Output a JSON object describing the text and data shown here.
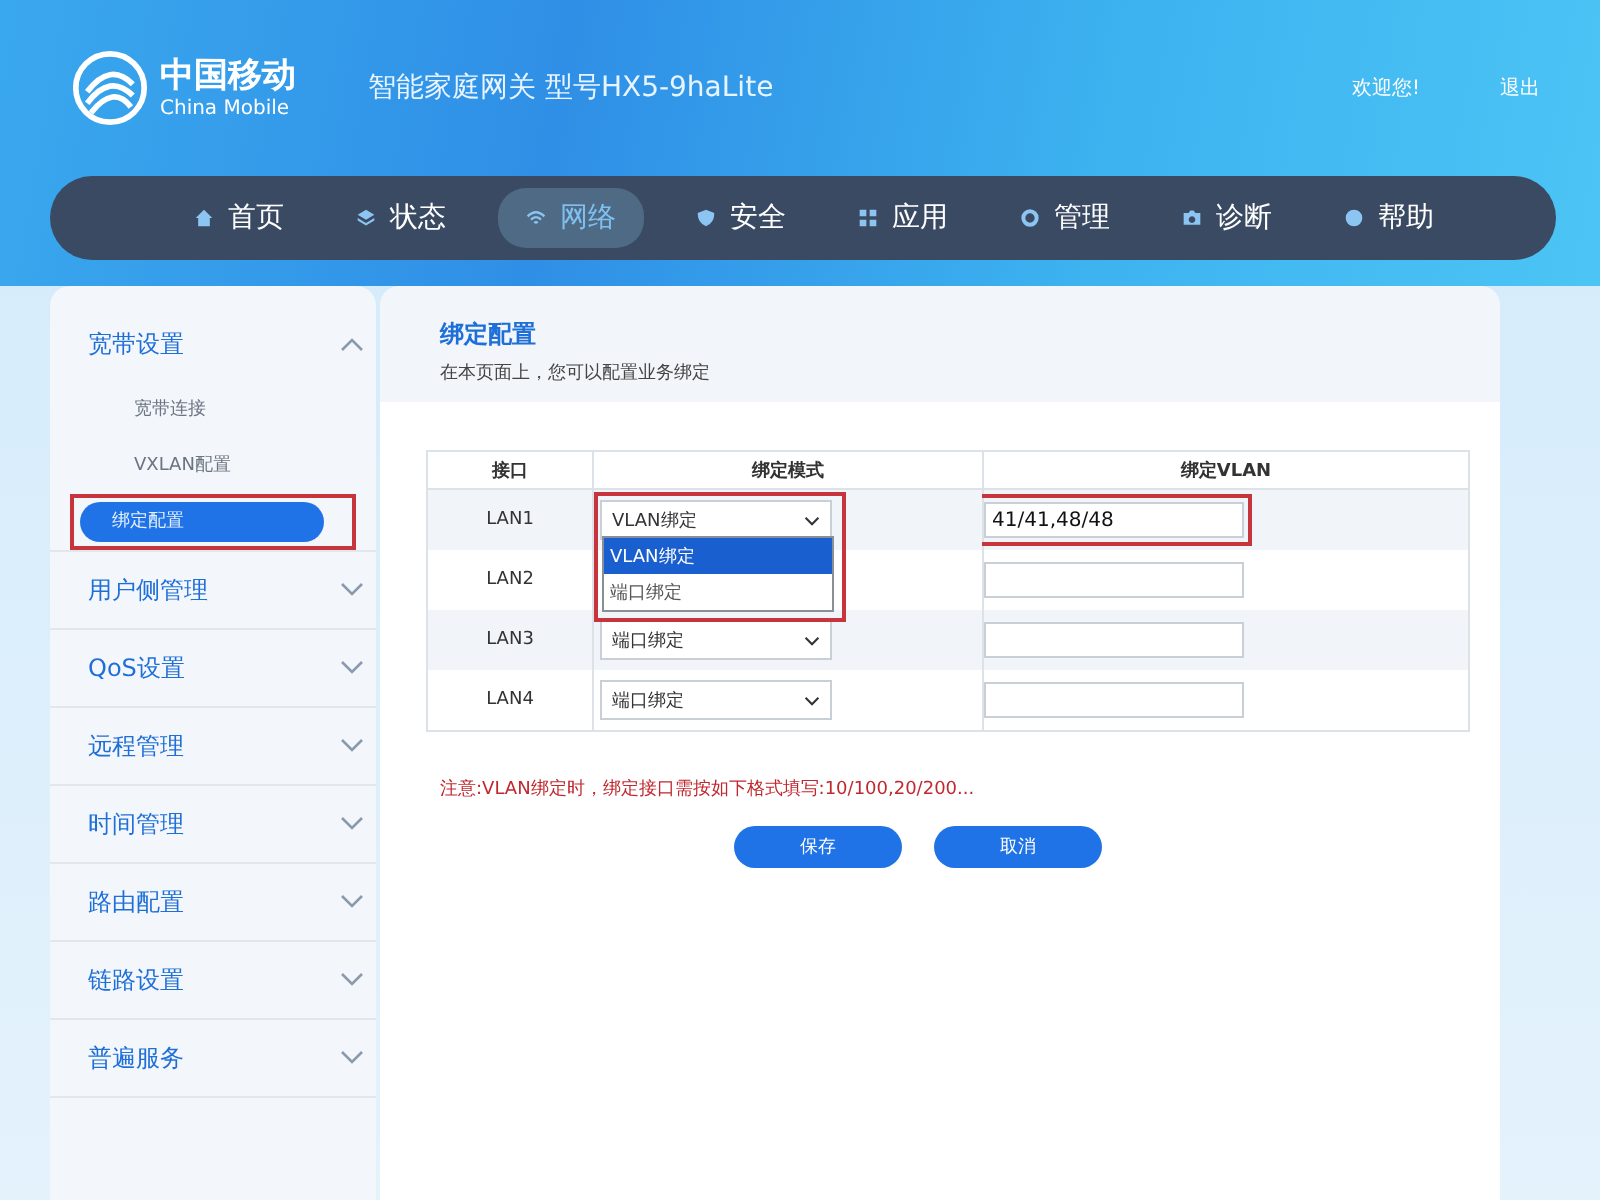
{
  "header": {
    "brand_cn": "中国移动",
    "brand_en": "China Mobile",
    "device": "智能家庭网关 型号HX5-9haLite",
    "welcome": "欢迎您!",
    "logout": "退出"
  },
  "nav": [
    {
      "label": "首页",
      "kind": "home",
      "selected": false
    },
    {
      "label": "状态",
      "kind": "layers",
      "selected": false
    },
    {
      "label": "网络",
      "kind": "wifi",
      "selected": true
    },
    {
      "label": "安全",
      "kind": "shield",
      "selected": false
    },
    {
      "label": "应用",
      "kind": "grid",
      "selected": false
    },
    {
      "label": "管理",
      "kind": "gear",
      "selected": false
    },
    {
      "label": "诊断",
      "kind": "camera",
      "selected": false
    },
    {
      "label": "帮助",
      "kind": "help",
      "selected": false
    }
  ],
  "sidebar": [
    {
      "label": "宽带设置",
      "expanded": true,
      "children": [
        {
          "label": "宽带连接",
          "selected": false,
          "highlighted": false
        },
        {
          "label": "VXLAN配置",
          "selected": false,
          "highlighted": false
        },
        {
          "label": "绑定配置",
          "selected": true,
          "highlighted": true
        }
      ]
    },
    {
      "label": "用户侧管理",
      "expanded": false
    },
    {
      "label": "QoS设置",
      "expanded": false
    },
    {
      "label": "远程管理",
      "expanded": false
    },
    {
      "label": "时间管理",
      "expanded": false
    },
    {
      "label": "路由配置",
      "expanded": false
    },
    {
      "label": "链路设置",
      "expanded": false
    },
    {
      "label": "普遍服务",
      "expanded": false
    }
  ],
  "panel": {
    "title": "绑定配置",
    "subtitle": "在本页面上，您可以配置业务绑定"
  },
  "table": {
    "columns": [
      "接口",
      "绑定模式",
      "绑定VLAN"
    ],
    "rows": [
      {
        "port": "LAN1",
        "mode": "VLAN绑定",
        "vlan": "41/41,48/48",
        "dropdown_open": true,
        "highlighted": true
      },
      {
        "port": "LAN2",
        "dropdown_open": false,
        "highlighted": false
      },
      {
        "port": "LAN3",
        "mode": "端口绑定",
        "dropdown_open": false,
        "highlighted": false
      },
      {
        "port": "LAN4",
        "mode": "端口绑定",
        "dropdown_open": false,
        "highlighted": false
      }
    ]
  },
  "dropdown": {
    "options": [
      {
        "label": "VLAN绑定",
        "selected": true
      },
      {
        "label": "端口绑定",
        "selected": false
      }
    ]
  },
  "note": "注意:VLAN绑定时，绑定接口需按如下格式填写:10/100,20/200...",
  "buttons": [
    "保存",
    "取消"
  ]
}
